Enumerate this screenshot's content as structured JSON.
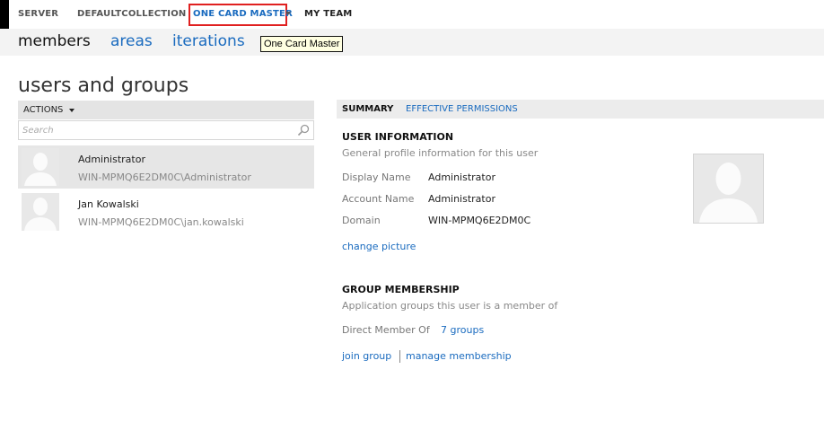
{
  "topnav": {
    "server": "SERVER",
    "collection": "DEFAULTCOLLECTION",
    "project": "ONE CARD MASTER",
    "team": "MY TEAM"
  },
  "subnav": {
    "members": "members",
    "areas": "areas",
    "iterations": "iterations"
  },
  "tooltip": "One Card Master",
  "page": {
    "title": "users and groups",
    "actions_label": "ACTIONS",
    "search_placeholder": "Search"
  },
  "users": [
    {
      "name": "Administrator",
      "account": "WIN-MPMQ6E2DM0C\\Administrator",
      "selected": true
    },
    {
      "name": "Jan Kowalski",
      "account": "WIN-MPMQ6E2DM0C\\jan.kowalski",
      "selected": false
    }
  ],
  "detail_tabs": {
    "summary": "SUMMARY",
    "permissions": "EFFECTIVE PERMISSIONS"
  },
  "user_info": {
    "title": "USER INFORMATION",
    "subtitle": "General profile information for this user",
    "display_name_label": "Display Name",
    "display_name": "Administrator",
    "account_name_label": "Account Name",
    "account_name": "Administrator",
    "domain_label": "Domain",
    "domain": "WIN-MPMQ6E2DM0C",
    "change_picture": "change picture"
  },
  "group_membership": {
    "title": "GROUP MEMBERSHIP",
    "subtitle": "Application groups this user is a member of",
    "direct_member_label": "Direct Member Of",
    "direct_member_value": "7 groups",
    "join_group": "join group",
    "manage_membership": "manage membership"
  },
  "colors": {
    "link": "#1a6bbf",
    "highlight_border": "#e02020",
    "selected_row": "#e6e6e6"
  }
}
